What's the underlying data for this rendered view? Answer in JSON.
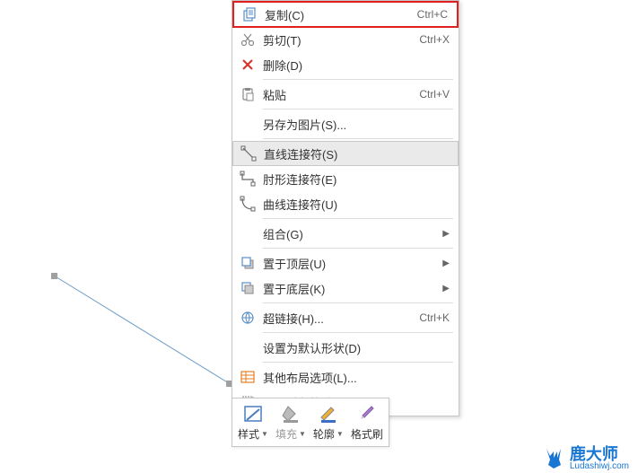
{
  "menu": {
    "copy": {
      "label": "复制(C)",
      "shortcut": "Ctrl+C"
    },
    "cut": {
      "label": "剪切(T)",
      "shortcut": "Ctrl+X"
    },
    "delete": {
      "label": "删除(D)"
    },
    "paste": {
      "label": "粘贴",
      "shortcut": "Ctrl+V"
    },
    "saveAsImage": {
      "label": "另存为图片(S)..."
    },
    "straightConnector": {
      "label": "直线连接符(S)"
    },
    "elbowConnector": {
      "label": "肘形连接符(E)"
    },
    "curvedConnector": {
      "label": "曲线连接符(U)"
    },
    "group": {
      "label": "组合(G)"
    },
    "bringFront": {
      "label": "置于顶层(U)"
    },
    "sendBack": {
      "label": "置于底层(K)"
    },
    "hyperlink": {
      "label": "超链接(H)...",
      "shortcut": "Ctrl+K"
    },
    "setDefault": {
      "label": "设置为默认形状(D)"
    },
    "layoutOptions": {
      "label": "其他布局选项(L)..."
    },
    "formatObject": {
      "label": "设置对象格式(O)..."
    }
  },
  "toolbar": {
    "style": "样式",
    "fill": "填充",
    "outline": "轮廓",
    "formatPainter": "格式刷"
  },
  "watermark": {
    "name": "鹿大师",
    "url": "Ludashiwj.com"
  }
}
